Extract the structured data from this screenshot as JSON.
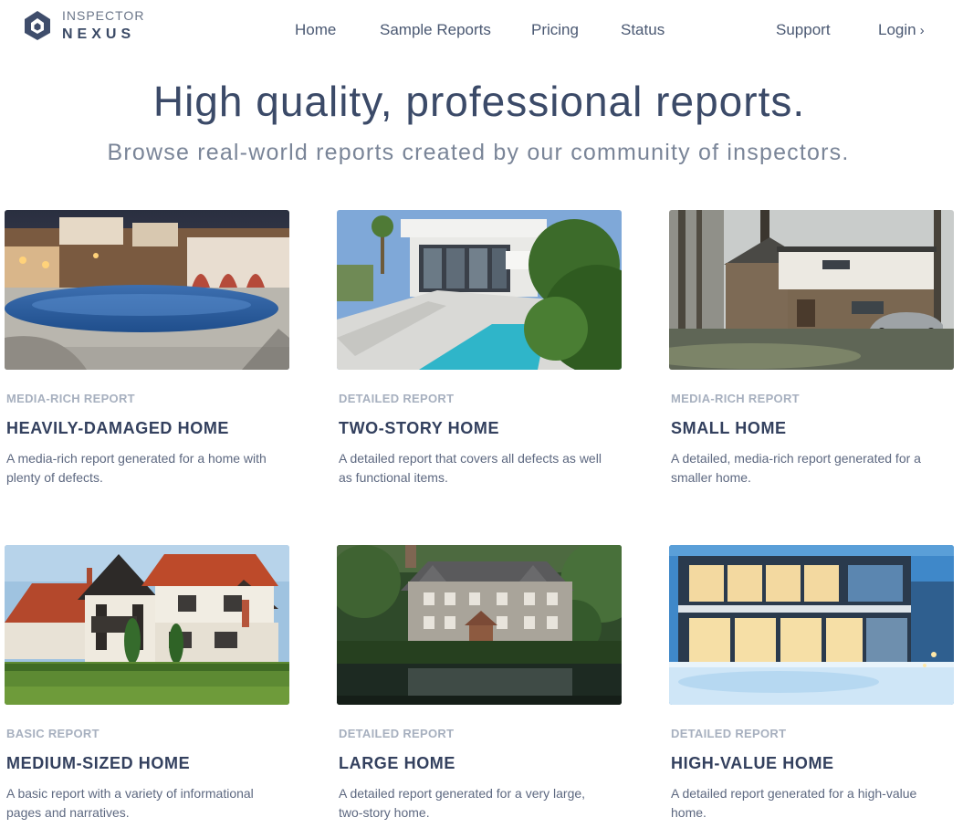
{
  "brand": {
    "top": "INSPECTOR",
    "bottom": "NEXUS"
  },
  "nav": {
    "home": "Home",
    "sample_reports": "Sample Reports",
    "pricing": "Pricing",
    "status": "Status",
    "support": "Support",
    "login": "Login"
  },
  "hero": {
    "title": "High quality, professional reports.",
    "subtitle": "Browse real-world reports created by our community of inspectors."
  },
  "cards": [
    {
      "type": "MEDIA-RICH REPORT",
      "title": "HEAVILY-DAMAGED HOME",
      "description": "A media-rich report generated for a home with plenty of defects."
    },
    {
      "type": "DETAILED REPORT",
      "title": "TWO-STORY HOME",
      "description": "A detailed report that covers all defects as well as functional items."
    },
    {
      "type": "MEDIA-RICH REPORT",
      "title": "SMALL HOME",
      "description": "A detailed, media-rich report generated for a smaller home."
    },
    {
      "type": "BASIC REPORT",
      "title": "MEDIUM-SIZED HOME",
      "description": "A basic report with a variety of informational pages and narratives."
    },
    {
      "type": "DETAILED REPORT",
      "title": "LARGE HOME",
      "description": "A detailed report generated for a very large, two-story home."
    },
    {
      "type": "DETAILED REPORT",
      "title": "HIGH-VALUE HOME",
      "description": "A detailed report generated for a high-value home."
    }
  ]
}
